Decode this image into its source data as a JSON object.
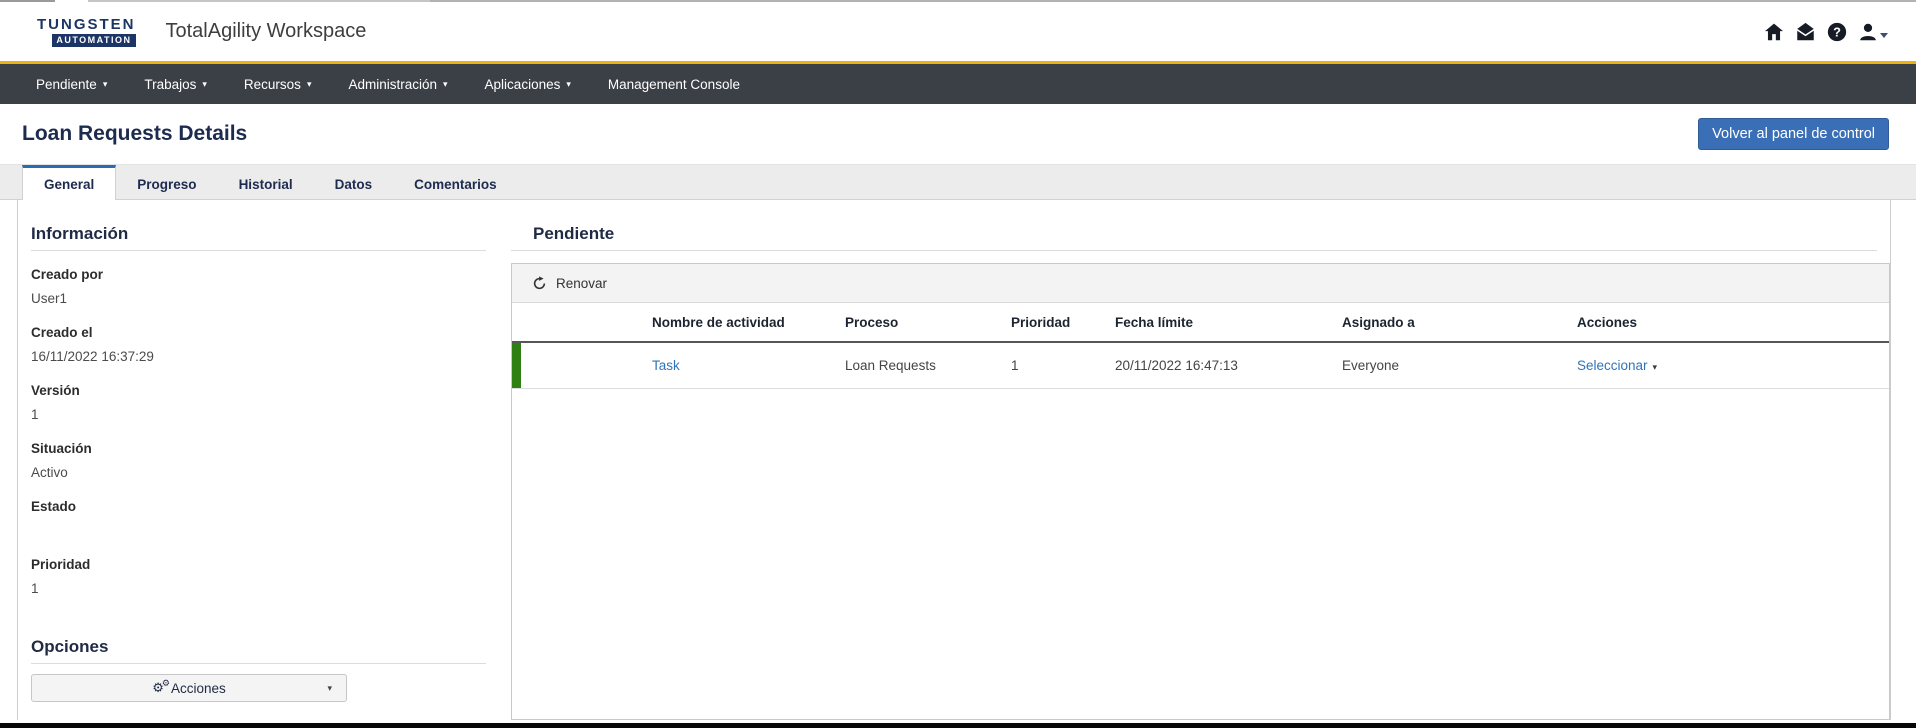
{
  "header": {
    "logo_line1": "TUNGSTEN",
    "logo_line2": "AUTOMATION",
    "app_title": "TotalAgility Workspace"
  },
  "navbar": {
    "items": [
      {
        "label": "Pendiente",
        "caret": "▾"
      },
      {
        "label": "Trabajos",
        "caret": "▾"
      },
      {
        "label": "Recursos",
        "caret": "▾"
      },
      {
        "label": "Administración",
        "caret": "▾"
      },
      {
        "label": "Aplicaciones",
        "caret": "▾"
      },
      {
        "label": "Management Console",
        "caret": ""
      }
    ]
  },
  "page": {
    "title": "Loan Requests Details",
    "back_button_label": "Volver al panel de control"
  },
  "tabs": {
    "active_tab": "General",
    "items": [
      {
        "label": "General"
      },
      {
        "label": "Progreso"
      },
      {
        "label": "Historial"
      },
      {
        "label": "Datos"
      },
      {
        "label": "Comentarios"
      }
    ]
  },
  "info": {
    "heading": "Información",
    "fields": [
      {
        "label": "Creado por",
        "value": "User1"
      },
      {
        "label": "Creado el",
        "value": "16/11/2022 16:37:29"
      },
      {
        "label": "Versión",
        "value": "1"
      },
      {
        "label": "Situación",
        "value": "Activo"
      },
      {
        "label": "Estado",
        "value": ""
      },
      {
        "label": "Prioridad",
        "value": "1"
      }
    ],
    "options_heading": "Opciones",
    "actions_button_label": "Acciones"
  },
  "pending": {
    "heading": "Pendiente",
    "refresh_label": "Renovar",
    "columns": [
      "Nombre de actividad",
      "Proceso",
      "Prioridad",
      "Fecha límite",
      "Asignado a",
      "Acciones"
    ],
    "row": {
      "activity": "Task",
      "process": "Loan Requests",
      "priority": "1",
      "due_date": "20/11/2022 16:47:13",
      "assigned_to": "Everyone",
      "action_label": "Seleccionar"
    }
  },
  "icons": {
    "chevron_down": "▾",
    "gear": "⚙",
    "question": "?"
  },
  "colors": {
    "accent_yellow": "#eeb111",
    "navbar_bg": "#3b3f46",
    "link_blue": "#3273b8",
    "button_blue": "#3a6fb7",
    "active_tab_blue": "#2a6cb4",
    "row_indicator_green": "#2e8012",
    "heading_navy": "#1f2a44"
  }
}
